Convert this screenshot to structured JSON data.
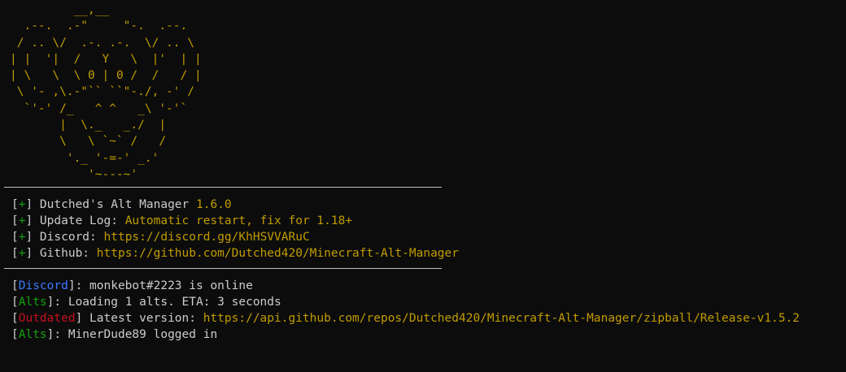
{
  "ascii_art": "         __,__\n  .--.  .-\"     \"-.  .--.\n / .. \\/  .-. .-.  \\/ .. \\\n| |  '|  /   Y   \\  |'  | |\n| \\   \\  \\ 0 | 0 /  /   / |\n \\ '- ,\\.-\"`` ``\"-./, -' /\n  `'-' /_   ^ ^   _\\ '-'`\n       |  \\._   _./  |\n       \\   \\ `~` /   /\n        '._ '-=-' _.'\n           '~---~'",
  "info": [
    {
      "tag_open": "[",
      "tag": "+",
      "tag_close": "]",
      "label": " Dutched's Alt Manager ",
      "value": "1.6.0"
    },
    {
      "tag_open": "[",
      "tag": "+",
      "tag_close": "]",
      "label": " Update Log: ",
      "value": "Automatic restart, fix for 1.18+"
    },
    {
      "tag_open": "[",
      "tag": "+",
      "tag_close": "]",
      "label": " Discord: ",
      "value": "https://discord.gg/KhHSVVARuC"
    },
    {
      "tag_open": "[",
      "tag": "+",
      "tag_close": "]",
      "label": " Github: ",
      "value": "https://github.com/Dutched420/Minecraft-Alt-Manager"
    }
  ],
  "log": [
    {
      "tag": "Discord",
      "text": ": monkebot#2223 is online",
      "link": ""
    },
    {
      "tag": "Alts",
      "text": ": Loading 1 alts. ETA: 3 seconds",
      "link": ""
    },
    {
      "tag": "Outdated",
      "text": " Latest version: ",
      "link": "https://api.github.com/repos/Dutched420/Minecraft-Alt-Manager/zipball/Release-v1.5.2"
    },
    {
      "tag": "Alts",
      "text": ": MinerDude89 logged in",
      "link": ""
    }
  ],
  "colors": {
    "background": "#0c0c0c",
    "text": "#cccccc",
    "art": "#c19c00",
    "plus": "#13a10e",
    "discord_tag": "#3b78ff",
    "outdated_tag": "#c50f1f",
    "alts_tag": "#13a10e",
    "divider": "#bfbfbf"
  }
}
